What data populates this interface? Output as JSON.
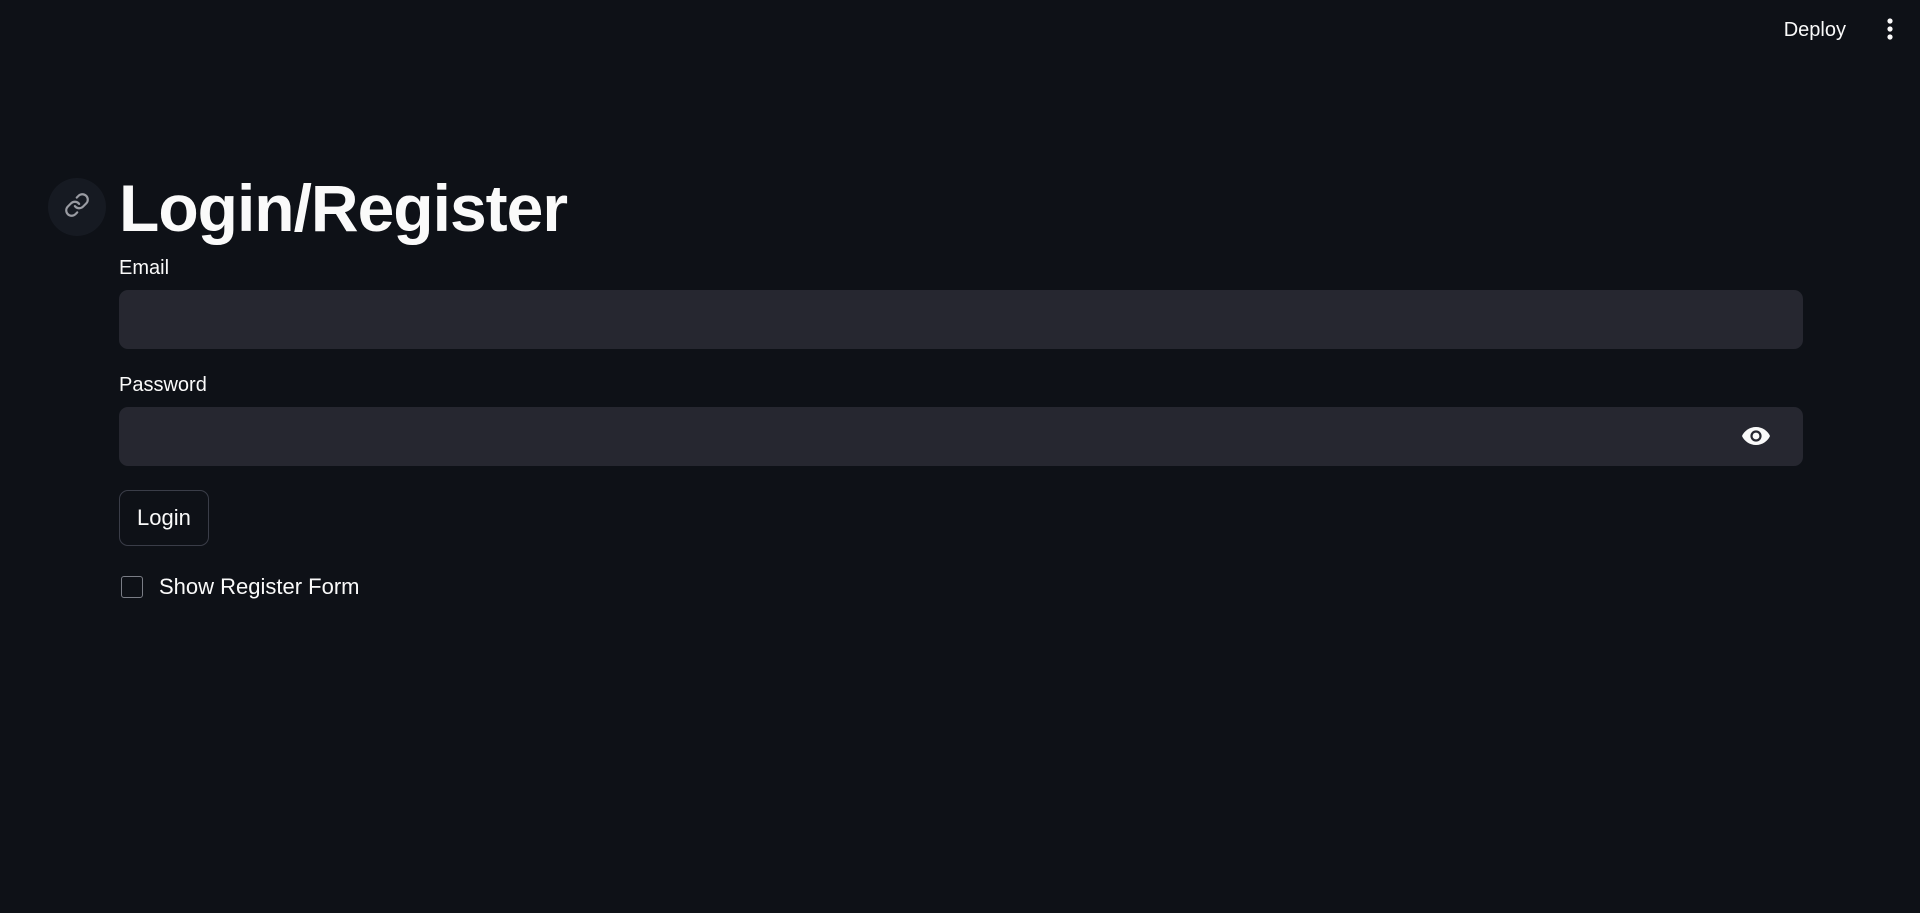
{
  "header": {
    "deploy_label": "Deploy",
    "menu_icon": "more-vertical-icon"
  },
  "main": {
    "anchor_icon": "link-icon",
    "title": "Login/Register",
    "email": {
      "label": "Email",
      "value": "",
      "placeholder": ""
    },
    "password": {
      "label": "Password",
      "value": "",
      "placeholder": "",
      "toggle_icon": "eye-icon"
    },
    "login_label": "Login",
    "register_checkbox": {
      "label": "Show Register Form",
      "checked": false
    }
  },
  "colors": {
    "background": "#0e1117",
    "input_background": "#262730",
    "text": "#fafafa",
    "border": "#3a3d48"
  }
}
